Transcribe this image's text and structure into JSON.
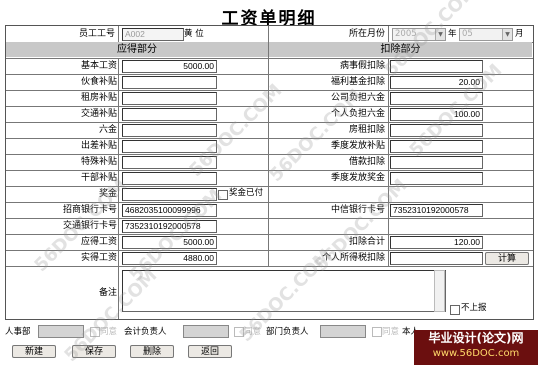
{
  "title": "工资单明细",
  "header": {
    "emp_id_label": "员工工号",
    "emp_id_value": "A002",
    "emp_name": "黄 位",
    "month_label": "所在月份",
    "year_value": "2005",
    "year_unit": "年",
    "month_value": "05",
    "month_unit": "月"
  },
  "sections": {
    "income": "应得部分",
    "deduct": "扣除部分"
  },
  "income": [
    {
      "label": "基本工资",
      "value": "5000.00"
    },
    {
      "label": "伙食补贴",
      "value": ""
    },
    {
      "label": "租房补贴",
      "value": ""
    },
    {
      "label": "交通补贴",
      "value": ""
    },
    {
      "label": "六金",
      "value": ""
    },
    {
      "label": "出差补贴",
      "value": ""
    },
    {
      "label": "特殊补贴",
      "value": ""
    },
    {
      "label": "干部补贴",
      "value": ""
    }
  ],
  "deduct": [
    {
      "label": "病事假扣除",
      "value": ""
    },
    {
      "label": "福利基金扣除",
      "value": "20.00"
    },
    {
      "label": "公司负担六金",
      "value": ""
    },
    {
      "label": "个人负担六金",
      "value": "100.00"
    },
    {
      "label": "房租扣除",
      "value": ""
    },
    {
      "label": "季度发放补贴",
      "value": ""
    },
    {
      "label": "借款扣除",
      "value": ""
    },
    {
      "label": "季度发放奖金",
      "value": ""
    }
  ],
  "bonus": {
    "label": "奖金",
    "value": "",
    "paid_label": "奖金已付"
  },
  "cmb_card": {
    "label": "招商银行卡号",
    "value": "4682035100099996"
  },
  "citic_card": {
    "label": "中信银行卡号",
    "value": "7352310192000578"
  },
  "comm_card": {
    "label": "交通银行卡号",
    "value": "7352310192000578"
  },
  "gross_pay": {
    "label": "应得工资",
    "value": "5000.00"
  },
  "deduct_total": {
    "label": "扣除合计",
    "value": "120.00"
  },
  "net_pay": {
    "label": "实得工资",
    "value": "4880.00"
  },
  "income_tax": {
    "label": "个人所得税扣除",
    "value": "",
    "button": "计算"
  },
  "remark": {
    "label": "备注",
    "value": "",
    "not_reported": "不上报"
  },
  "approvals": {
    "hr_label": "人事部",
    "agree": "同意",
    "accountant_label": "会计负责人",
    "dept_label": "部门负责人",
    "last_label": "本人"
  },
  "buttons": {
    "new": "新建",
    "save": "保存",
    "delete": "删除",
    "back": "返回"
  },
  "banner": {
    "line1": "毕业设计(论文)网",
    "line2": "www.56DOC.com"
  },
  "watermarks": [
    "56DOC.COM",
    "56DOC.COM",
    "56DOC.COM",
    "56DOC.COM",
    "56DOC.COM",
    "56DOC.COM",
    "56DOC.COM",
    "56DOC.COM",
    "56DOC.COM"
  ]
}
